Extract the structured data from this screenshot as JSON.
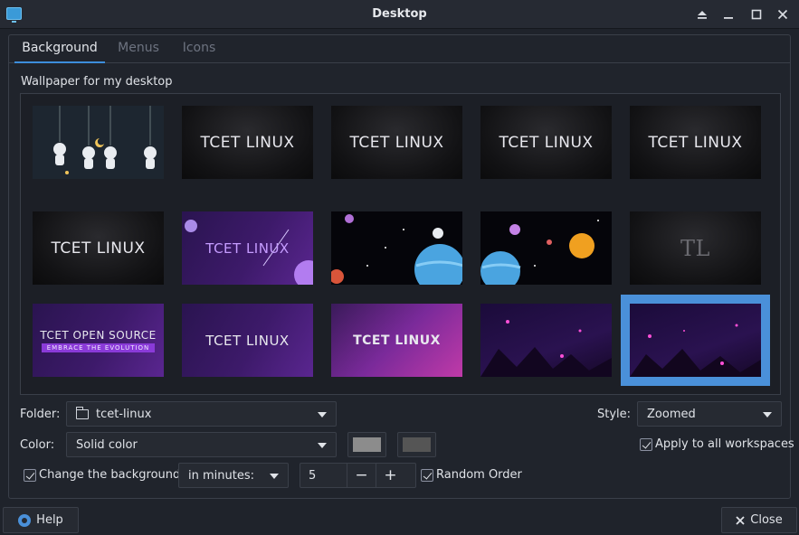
{
  "window": {
    "title": "Desktop",
    "controls": [
      "eject-icon",
      "minimize-icon",
      "maximize-icon",
      "close-icon"
    ]
  },
  "tabs": [
    {
      "label": "Background",
      "active": true
    },
    {
      "label": "Menus",
      "active": false
    },
    {
      "label": "Icons",
      "active": false
    }
  ],
  "wallpaper": {
    "section_label": "Wallpaper for my desktop",
    "selected_index": 14,
    "thumbnails": [
      {
        "caption": "",
        "theme": "navy"
      },
      {
        "caption": "TCET LINUX",
        "theme": "dark"
      },
      {
        "caption": "TCET LINUX",
        "theme": "dark"
      },
      {
        "caption": "TCET LINUX",
        "theme": "dark"
      },
      {
        "caption": "TCET LINUX",
        "theme": "dark"
      },
      {
        "caption": "TCET LINUX",
        "theme": "dark"
      },
      {
        "caption": "TCET LINUX",
        "theme": "purple"
      },
      {
        "caption": "",
        "theme": "space"
      },
      {
        "caption": "",
        "theme": "space"
      },
      {
        "caption": "TL",
        "theme": "dark"
      },
      {
        "caption": "TCET OPEN SOURCE",
        "subcaption": "EMBRACE THE EVOLUTION",
        "theme": "purple"
      },
      {
        "caption": "TCET LINUX",
        "theme": "purple"
      },
      {
        "caption": "TCET LINUX",
        "theme": "purple"
      },
      {
        "caption": "",
        "theme": "deep"
      },
      {
        "caption": "",
        "theme": "deep"
      }
    ]
  },
  "folder": {
    "label": "Folder:",
    "value": "tcet-linux"
  },
  "style": {
    "label": "Style:",
    "value": "Zoomed"
  },
  "color": {
    "label": "Color:",
    "value": "Solid color",
    "primary": "#8c8c8c",
    "secondary": "#555555"
  },
  "apply_all": {
    "label": "Apply to all workspaces",
    "checked": true
  },
  "change_bg": {
    "label": "Change the background",
    "checked": true,
    "interval_mode": "in minutes:",
    "interval_value": "5"
  },
  "random_order": {
    "label": "Random Order",
    "checked": true
  },
  "buttons": {
    "help": "Help",
    "close": "Close"
  }
}
